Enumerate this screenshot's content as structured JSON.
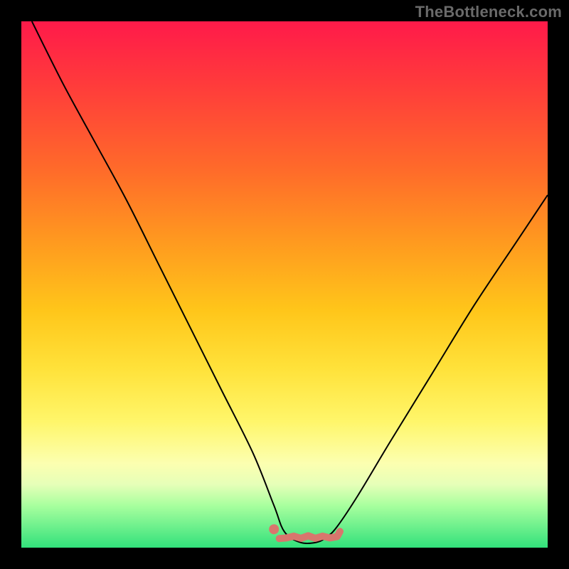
{
  "watermark": "TheBottleneck.com",
  "colors": {
    "frame_bg": "#000000",
    "gradient_top": "#ff1a4a",
    "gradient_bottom": "#32e17b",
    "curve_stroke": "#000000",
    "marker_stroke": "#d8766d"
  },
  "chart_data": {
    "type": "line",
    "title": "",
    "xlabel": "",
    "ylabel": "",
    "xlim": [
      0,
      100
    ],
    "ylim": [
      0,
      100
    ],
    "series": [
      {
        "name": "bottleneck-curve",
        "x": [
          2,
          8,
          14,
          20,
          26,
          32,
          38,
          44,
          48,
          50,
          53,
          56,
          58,
          60,
          64,
          70,
          78,
          86,
          94,
          100
        ],
        "y": [
          100,
          88,
          77,
          66,
          54,
          42,
          30,
          18,
          8,
          3,
          1,
          1,
          2,
          4,
          10,
          20,
          33,
          46,
          58,
          67
        ]
      }
    ],
    "annotations": [
      {
        "name": "optimal-range-marker",
        "type": "segment",
        "x": [
          49,
          60
        ],
        "y": [
          2,
          2
        ]
      },
      {
        "name": "optimal-range-dot",
        "type": "point",
        "x": 48,
        "y": 3.5
      }
    ]
  }
}
